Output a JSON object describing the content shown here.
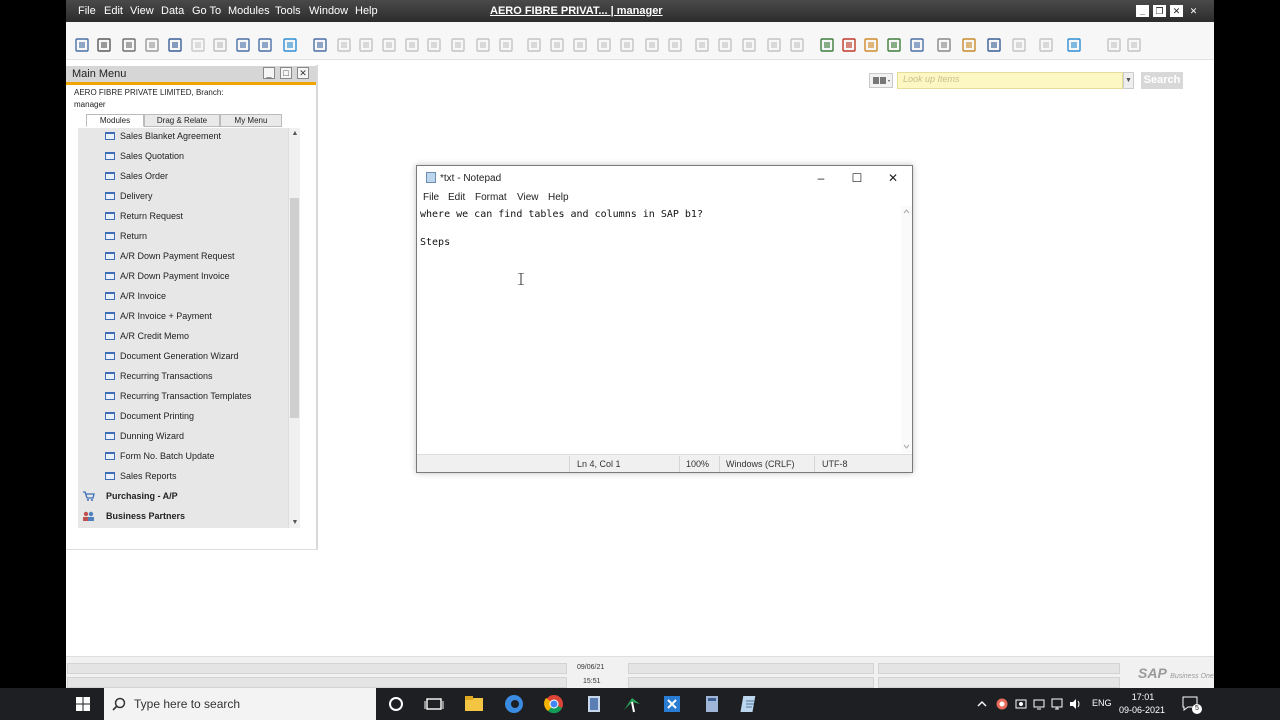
{
  "app": {
    "title": "AERO FIBRE PRIVAT... | manager",
    "menu": [
      "File",
      "Edit",
      "View",
      "Data",
      "Go To",
      "Modules",
      "Tools",
      "Window",
      "Help"
    ]
  },
  "lookup": {
    "placeholder": "Look up Items",
    "search_label": "Search"
  },
  "main_menu": {
    "title": "Main Menu",
    "company": "AERO FIBRE PRIVATE LIMITED, Branch:",
    "user": "manager",
    "tabs": [
      "Modules",
      "Drag & Relate",
      "My Menu"
    ],
    "items": [
      "Sales Blanket Agreement",
      "Sales Quotation",
      "Sales Order",
      "Delivery",
      "Return Request",
      "Return",
      "A/R Down Payment Request",
      "A/R Down Payment Invoice",
      "A/R Invoice",
      "A/R Invoice + Payment",
      "A/R Credit Memo",
      "Document Generation Wizard",
      "Recurring Transactions",
      "Recurring Transaction Templates",
      "Document Printing",
      "Dunning Wizard",
      "Form No. Batch Update",
      "Sales Reports"
    ],
    "categories": [
      "Purchasing - A/P",
      "Business Partners"
    ]
  },
  "notepad": {
    "title": "*txt - Notepad",
    "menu": [
      "File",
      "Edit",
      "Format",
      "View",
      "Help"
    ],
    "line1": "where we can find tables and columns in SAP b1?",
    "line3": "Steps",
    "status_pos": "Ln 4, Col 1",
    "status_zoom": "100%",
    "status_eol": "Windows (CRLF)",
    "status_enc": "UTF-8"
  },
  "sap_status": {
    "date": "09/06/21",
    "time": "15:51",
    "logo": "SAP",
    "logo_sub": "Business One"
  },
  "taskbar": {
    "search_placeholder": "Type here to search",
    "lang": "ENG",
    "time": "17:01",
    "date": "09-06-2021",
    "notif_count": "5"
  }
}
